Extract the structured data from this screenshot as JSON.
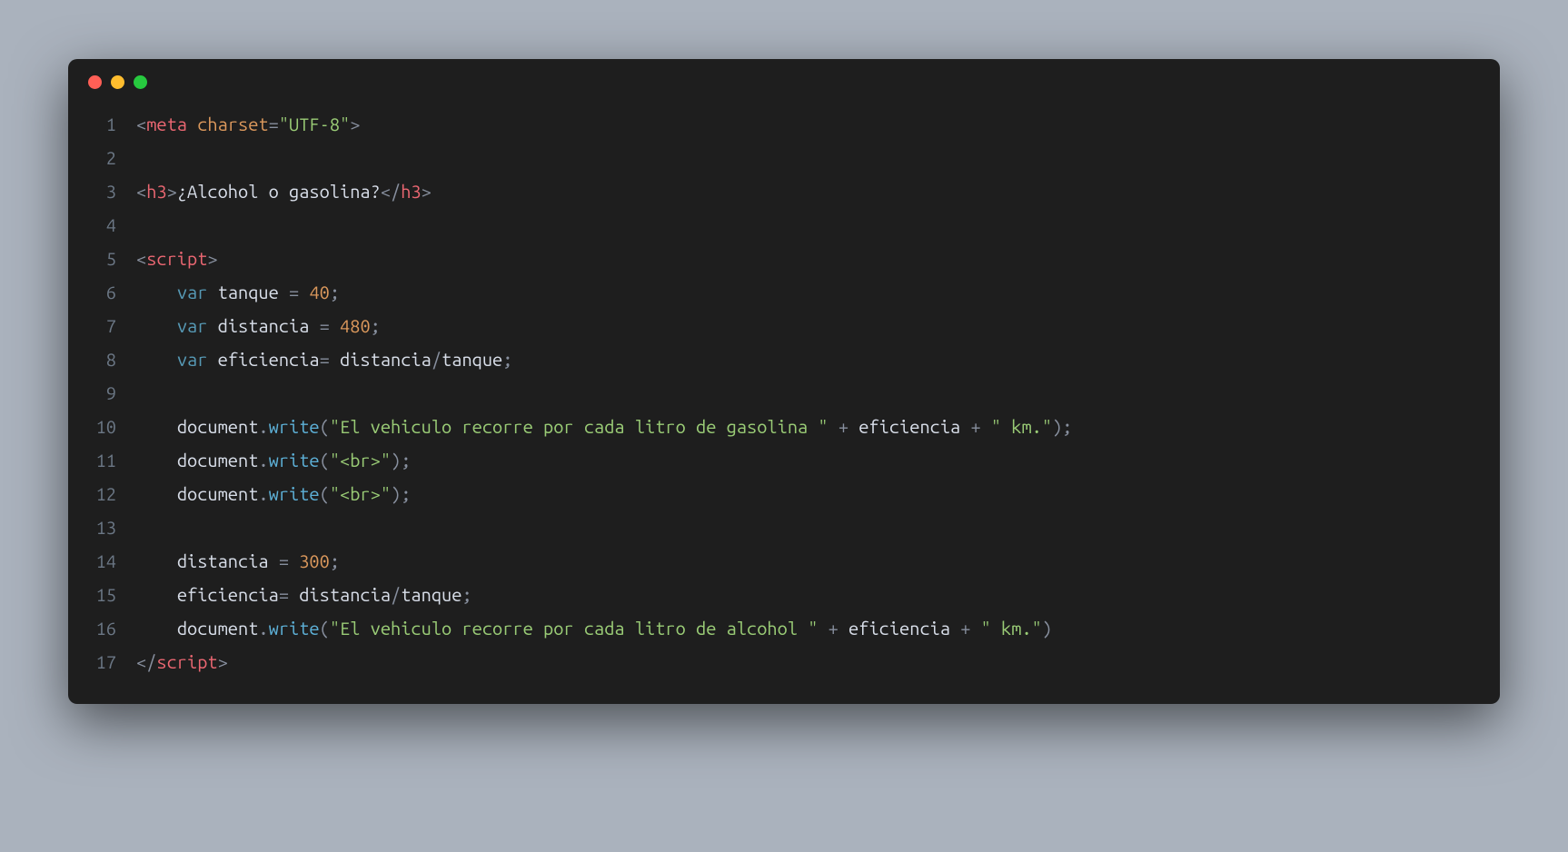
{
  "traffic_lights": [
    "close",
    "minimize",
    "zoom"
  ],
  "lines": [
    {
      "n": "1",
      "tokens": [
        {
          "t": "<",
          "c": "punct"
        },
        {
          "t": "meta",
          "c": "tag"
        },
        {
          "t": " ",
          "c": "text"
        },
        {
          "t": "charset",
          "c": "attr"
        },
        {
          "t": "=",
          "c": "punct"
        },
        {
          "t": "\"UTF-8\"",
          "c": "str"
        },
        {
          "t": ">",
          "c": "punct"
        }
      ]
    },
    {
      "n": "2",
      "tokens": []
    },
    {
      "n": "3",
      "tokens": [
        {
          "t": "<",
          "c": "punct"
        },
        {
          "t": "h3",
          "c": "tag"
        },
        {
          "t": ">",
          "c": "punct"
        },
        {
          "t": "¿Alcohol o gasolina?",
          "c": "text"
        },
        {
          "t": "</",
          "c": "punct"
        },
        {
          "t": "h3",
          "c": "tag"
        },
        {
          "t": ">",
          "c": "punct"
        }
      ]
    },
    {
      "n": "4",
      "tokens": []
    },
    {
      "n": "5",
      "tokens": [
        {
          "t": "<",
          "c": "punct"
        },
        {
          "t": "script",
          "c": "tag"
        },
        {
          "t": ">",
          "c": "punct"
        }
      ]
    },
    {
      "n": "6",
      "tokens": [
        {
          "t": "    ",
          "c": "text"
        },
        {
          "t": "var",
          "c": "kw"
        },
        {
          "t": " ",
          "c": "text"
        },
        {
          "t": "tanque",
          "c": "ident"
        },
        {
          "t": " = ",
          "c": "punct"
        },
        {
          "t": "40",
          "c": "num"
        },
        {
          "t": ";",
          "c": "punct"
        }
      ]
    },
    {
      "n": "7",
      "tokens": [
        {
          "t": "    ",
          "c": "text"
        },
        {
          "t": "var",
          "c": "kw"
        },
        {
          "t": " ",
          "c": "text"
        },
        {
          "t": "distancia",
          "c": "ident"
        },
        {
          "t": " = ",
          "c": "punct"
        },
        {
          "t": "480",
          "c": "num"
        },
        {
          "t": ";",
          "c": "punct"
        }
      ]
    },
    {
      "n": "8",
      "tokens": [
        {
          "t": "    ",
          "c": "text"
        },
        {
          "t": "var",
          "c": "kw"
        },
        {
          "t": " ",
          "c": "text"
        },
        {
          "t": "eficiencia",
          "c": "ident"
        },
        {
          "t": "= ",
          "c": "punct"
        },
        {
          "t": "distancia",
          "c": "ident"
        },
        {
          "t": "/",
          "c": "punct"
        },
        {
          "t": "tanque",
          "c": "ident"
        },
        {
          "t": ";",
          "c": "punct"
        }
      ]
    },
    {
      "n": "9",
      "tokens": []
    },
    {
      "n": "10",
      "tokens": [
        {
          "t": "    ",
          "c": "text"
        },
        {
          "t": "document",
          "c": "ident"
        },
        {
          "t": ".",
          "c": "punct"
        },
        {
          "t": "write",
          "c": "fn"
        },
        {
          "t": "(",
          "c": "punct"
        },
        {
          "t": "\"El vehiculo recorre por cada litro de gasolina \"",
          "c": "str"
        },
        {
          "t": " + ",
          "c": "punct"
        },
        {
          "t": "eficiencia",
          "c": "ident"
        },
        {
          "t": " + ",
          "c": "punct"
        },
        {
          "t": "\" km.\"",
          "c": "str"
        },
        {
          "t": ");",
          "c": "punct"
        }
      ]
    },
    {
      "n": "11",
      "tokens": [
        {
          "t": "    ",
          "c": "text"
        },
        {
          "t": "document",
          "c": "ident"
        },
        {
          "t": ".",
          "c": "punct"
        },
        {
          "t": "write",
          "c": "fn"
        },
        {
          "t": "(",
          "c": "punct"
        },
        {
          "t": "\"<br>\"",
          "c": "str"
        },
        {
          "t": ");",
          "c": "punct"
        }
      ]
    },
    {
      "n": "12",
      "tokens": [
        {
          "t": "    ",
          "c": "text"
        },
        {
          "t": "document",
          "c": "ident"
        },
        {
          "t": ".",
          "c": "punct"
        },
        {
          "t": "write",
          "c": "fn"
        },
        {
          "t": "(",
          "c": "punct"
        },
        {
          "t": "\"<br>\"",
          "c": "str"
        },
        {
          "t": ");",
          "c": "punct"
        }
      ]
    },
    {
      "n": "13",
      "tokens": []
    },
    {
      "n": "14",
      "tokens": [
        {
          "t": "    ",
          "c": "text"
        },
        {
          "t": "distancia",
          "c": "ident"
        },
        {
          "t": " = ",
          "c": "punct"
        },
        {
          "t": "300",
          "c": "num"
        },
        {
          "t": ";",
          "c": "punct"
        }
      ]
    },
    {
      "n": "15",
      "tokens": [
        {
          "t": "    ",
          "c": "text"
        },
        {
          "t": "eficiencia",
          "c": "ident"
        },
        {
          "t": "= ",
          "c": "punct"
        },
        {
          "t": "distancia",
          "c": "ident"
        },
        {
          "t": "/",
          "c": "punct"
        },
        {
          "t": "tanque",
          "c": "ident"
        },
        {
          "t": ";",
          "c": "punct"
        }
      ]
    },
    {
      "n": "16",
      "tokens": [
        {
          "t": "    ",
          "c": "text"
        },
        {
          "t": "document",
          "c": "ident"
        },
        {
          "t": ".",
          "c": "punct"
        },
        {
          "t": "write",
          "c": "fn"
        },
        {
          "t": "(",
          "c": "punct"
        },
        {
          "t": "\"El vehiculo recorre por cada litro de alcohol \"",
          "c": "str"
        },
        {
          "t": " + ",
          "c": "punct"
        },
        {
          "t": "eficiencia",
          "c": "ident"
        },
        {
          "t": " + ",
          "c": "punct"
        },
        {
          "t": "\" km.\"",
          "c": "str"
        },
        {
          "t": ")",
          "c": "punct"
        }
      ]
    },
    {
      "n": "17",
      "tokens": [
        {
          "t": "</",
          "c": "punct"
        },
        {
          "t": "script",
          "c": "tag"
        },
        {
          "t": ">",
          "c": "punct"
        }
      ]
    }
  ]
}
